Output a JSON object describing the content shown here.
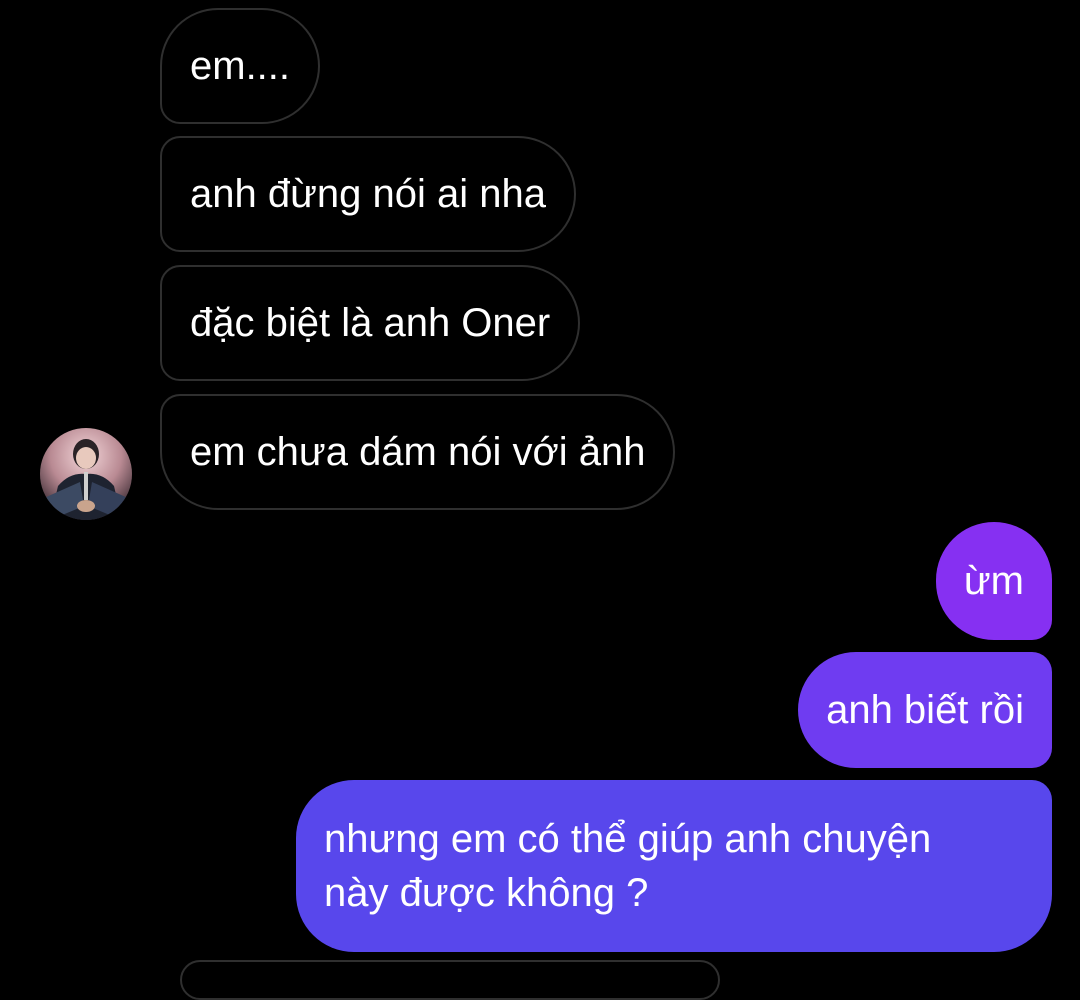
{
  "chat": {
    "received": [
      {
        "text": "em...."
      },
      {
        "text": "anh đừng nói ai nha"
      },
      {
        "text": "đặc biệt là anh Oner"
      },
      {
        "text": "em chưa dám nói với ảnh"
      }
    ],
    "sent": [
      {
        "text": "ừm"
      },
      {
        "text": "anh biết rồi"
      },
      {
        "text": "nhưng em có thể giúp anh chuyện này được không ?",
        "lines": [
          "nhưng em có thể giúp anh chuyện",
          "này được không ?"
        ]
      }
    ]
  },
  "colors": {
    "background": "#000000",
    "received_border": "#2f2f2f",
    "sent_gradient_top": "#8a2bf2",
    "sent_gradient_mid": "#6a3df0",
    "sent_gradient_bottom": "#5348ec"
  },
  "avatar": {
    "icon": "profile-photo-avatar"
  }
}
